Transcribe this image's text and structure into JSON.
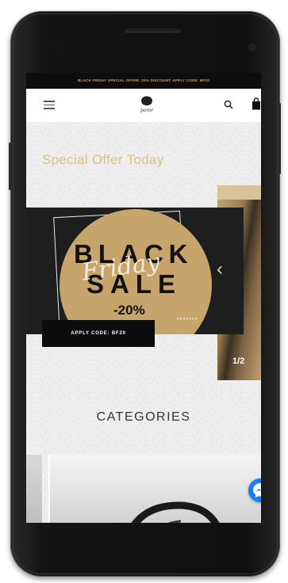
{
  "promo_bar": {
    "text": "BLACK FRIDAY SPECIAL OFFER: 20% DISCOUNT. APPLY CODE: BF20"
  },
  "header": {
    "logo_text": "pomr",
    "menu_icon": "hamburger-icon",
    "search_icon": "search-icon",
    "cart_icon": "shopping-bag-icon"
  },
  "offer": {
    "title": "Special Offer Today"
  },
  "carousel": {
    "headline_line1": "BLACK",
    "headline_line2": "SALE",
    "script_text": "Friday",
    "discount": "-20%",
    "dots": "•••••••",
    "apply_button": "APPLY CODE: BF20",
    "prev_icon": "chevron-left-icon",
    "next_icon": "chevron-right-icon",
    "slide_counter": "1/2"
  },
  "categories": {
    "title": "CATEGORIES"
  },
  "chat": {
    "icon": "messenger-icon"
  },
  "colors": {
    "accent_gold": "#c6a46b",
    "title_gold": "#d9bf8c",
    "dark": "#1e1e1e",
    "messenger_blue": "#1a7ef3"
  }
}
